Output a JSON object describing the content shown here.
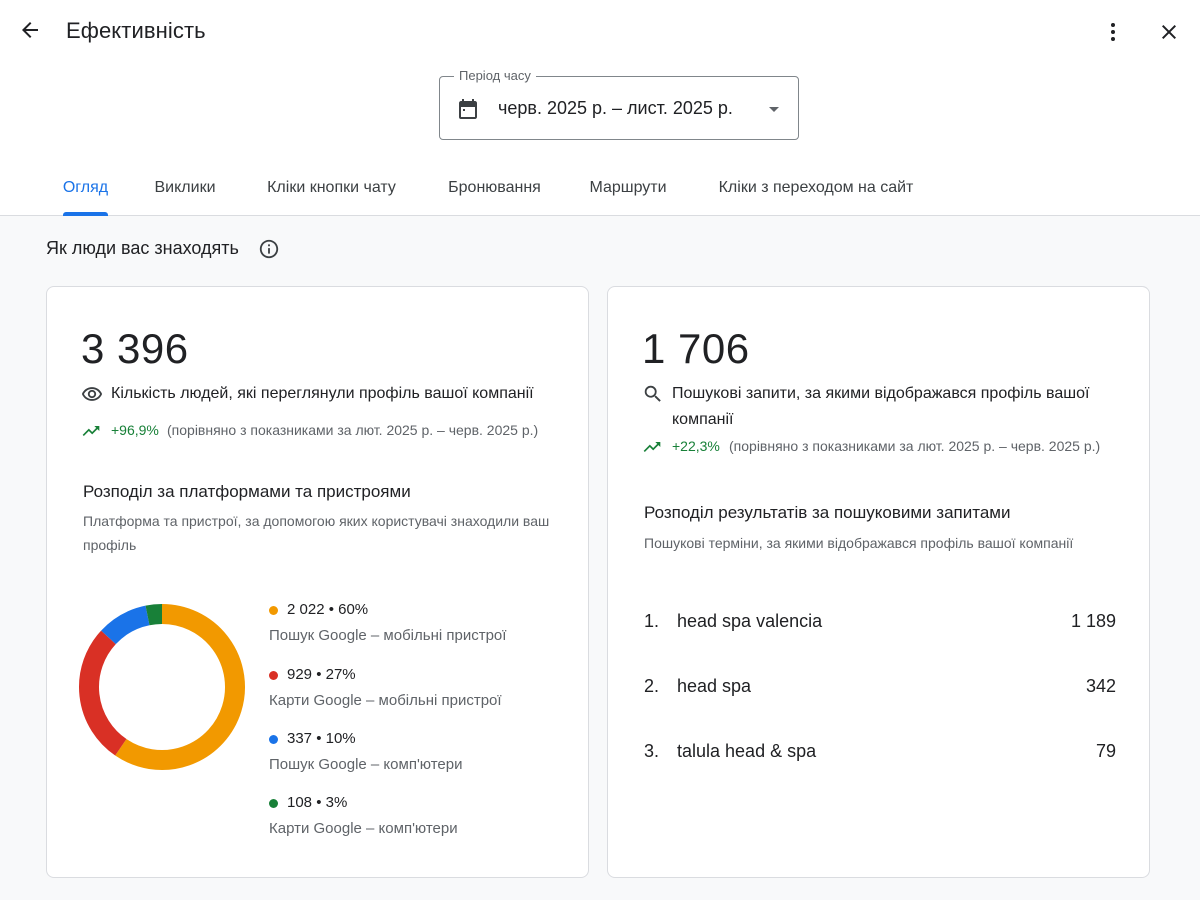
{
  "header": {
    "title": "Ефективність",
    "icons": {
      "back": "arrow-back-icon",
      "more": "more-vert-icon",
      "close": "close-icon"
    }
  },
  "period": {
    "legend": "Період часу",
    "value": "черв. 2025 р. – лист. 2025 р.",
    "icon": "calendar-icon"
  },
  "tabs": [
    {
      "label": "Огляд",
      "active": true
    },
    {
      "label": "Виклики",
      "active": false
    },
    {
      "label": "Кліки кнопки чату",
      "active": false
    },
    {
      "label": "Бронювання",
      "active": false
    },
    {
      "label": "Маршрути",
      "active": false
    },
    {
      "label": "Кліки з переходом на сайт",
      "active": false
    }
  ],
  "section": {
    "title": "Як люди вас знаходять",
    "info_icon": "info-icon"
  },
  "profile_views": {
    "value": "3 396",
    "label": "Кількість людей, які переглянули профіль вашої компанії",
    "icon": "eye-icon",
    "trend_value": "+96,9%",
    "trend_compare": "(порівняно з показниками за лют. 2025 р. – черв. 2025 р.)",
    "breakdown_title": "Розподіл за платформами та пристроями",
    "breakdown_desc": "Платформа та пристрої, за допомогою яких користувачі знаходили ваш профіль"
  },
  "searches": {
    "value": "1 706",
    "label": "Пошукові запити, за якими відображався профіль вашої компанії",
    "icon": "search-icon",
    "trend_value": "+22,3%",
    "trend_compare": "(порівняно з показниками за лют. 2025 р. – черв. 2025 р.)",
    "breakdown_title": "Розподіл результатів за пошуковими запитами",
    "breakdown_desc": "Пошукові терміни, за якими відображався профіль вашої компанії",
    "terms": [
      {
        "rank": "1.",
        "term": "head spa valencia",
        "count": "1 189"
      },
      {
        "rank": "2.",
        "term": "head spa",
        "count": "342"
      },
      {
        "rank": "3.",
        "term": "talula head & spa",
        "count": "79"
      }
    ]
  },
  "colors": {
    "accent": "#1a73e8",
    "trend_up": "#188038",
    "mobile_search": "#f29900",
    "mobile_maps": "#d93025",
    "desktop_search": "#1a73e8",
    "desktop_maps": "#188038"
  },
  "chart_data": {
    "type": "pie",
    "series": [
      {
        "value": 2022,
        "percent": 60,
        "value_label": "2 022 • 60%",
        "label": "Пошук Google – мобільні пристрої",
        "color": "#f29900"
      },
      {
        "value": 929,
        "percent": 27,
        "value_label": "929 • 27%",
        "label": "Карти Google – мобільні пристрої",
        "color": "#d93025"
      },
      {
        "value": 337,
        "percent": 10,
        "value_label": "337 • 10%",
        "label": "Пошук Google – комп'ютери",
        "color": "#1a73e8"
      },
      {
        "value": 108,
        "percent": 3,
        "value_label": "108 • 3%",
        "label": "Карти Google – комп'ютери",
        "color": "#188038"
      }
    ]
  }
}
